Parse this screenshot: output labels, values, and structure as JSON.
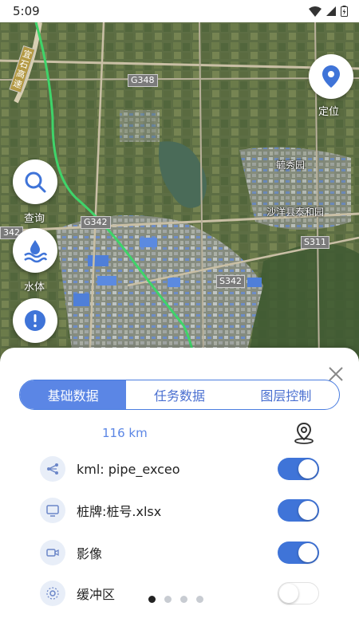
{
  "status_bar": {
    "time": "5:09"
  },
  "map": {
    "road_labels": [
      "G348",
      "G342",
      "S342",
      "S311",
      "342"
    ],
    "vertical_road_label": "宜石高速",
    "places": [
      "毓秀园",
      "沙洋县泰和园"
    ]
  },
  "buttons": {
    "locate": "定位",
    "search": "查询",
    "water": "水体"
  },
  "sheet": {
    "tabs": [
      "基础数据",
      "任务数据",
      "图层控制"
    ],
    "active_tab": 0,
    "distance": "116 km",
    "layers": [
      {
        "label": "kml: pipe_exceo",
        "icon": "route-icon",
        "enabled": true
      },
      {
        "label": "桩牌:桩号.xlsx",
        "icon": "monitor-icon",
        "enabled": true
      },
      {
        "label": "影像",
        "icon": "video-icon",
        "enabled": true
      },
      {
        "label": "缓冲区",
        "icon": "buffer-icon",
        "enabled": false
      }
    ],
    "pages": 4,
    "current_page": 0
  },
  "colors": {
    "accent": "#3f74d8",
    "route": "#3fd46a"
  }
}
